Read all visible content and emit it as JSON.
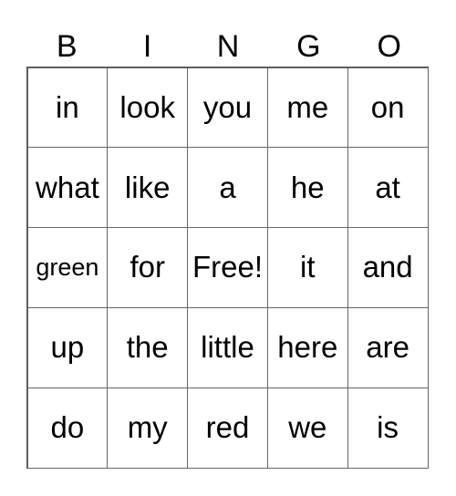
{
  "header": [
    "B",
    "I",
    "N",
    "G",
    "O"
  ],
  "rows": [
    [
      "in",
      "look",
      "you",
      "me",
      "on"
    ],
    [
      "what",
      "like",
      "a",
      "he",
      "at"
    ],
    [
      "green",
      "for",
      "Free!",
      "it",
      "and"
    ],
    [
      "up",
      "the",
      "little",
      "here",
      "are"
    ],
    [
      "do",
      "my",
      "red",
      "we",
      "is"
    ]
  ]
}
